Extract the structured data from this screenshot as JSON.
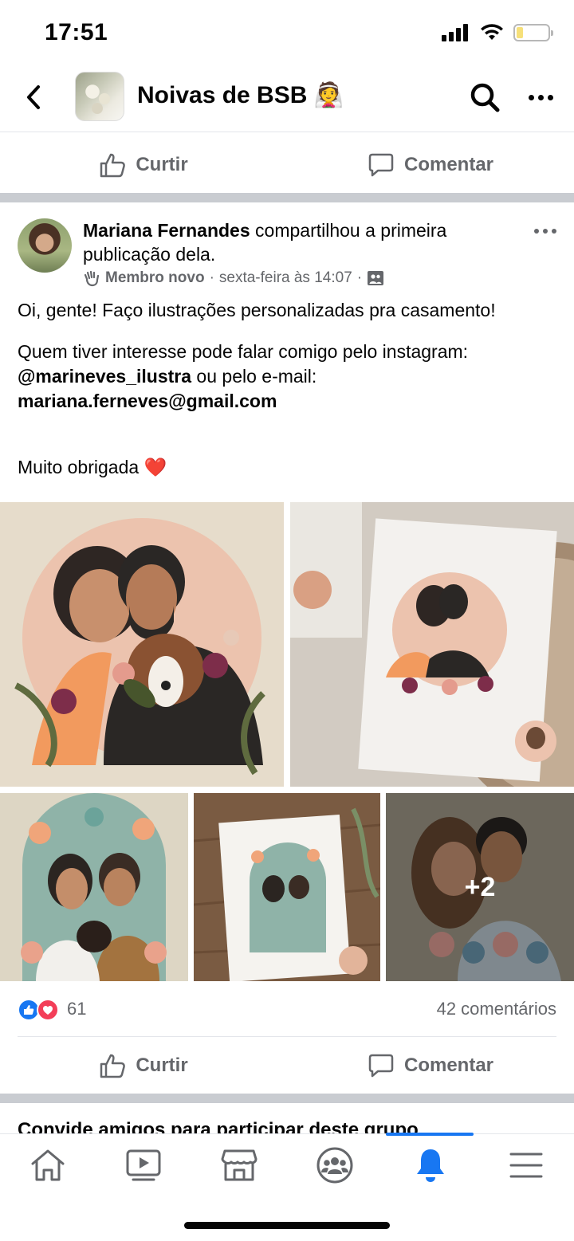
{
  "status_bar": {
    "time": "17:51"
  },
  "header": {
    "group_name": "Noivas de BSB 👰"
  },
  "actions_top": {
    "like": "Curtir",
    "comment": "Comentar"
  },
  "post": {
    "author": "Mariana Fernandes",
    "shared_text": " compartilhou a primeira publicação dela.",
    "badge": "Membro novo",
    "time": "sexta-feira às 14:07",
    "separator": "·",
    "body": {
      "line1": "Oi, gente! Faço ilustrações personalizadas pra casamento!",
      "line2_a": "Quem tiver interesse pode falar comigo pelo instagram:",
      "instagram": "@marineves_ilustra",
      "line2_b": " ou pelo e-mail:",
      "email": "mariana.ferneves@gmail.com",
      "thanks": "Muito obrigada ❤️"
    },
    "more_photos": "+2",
    "reaction_count": "61",
    "comments": "42 comentários"
  },
  "actions_bottom": {
    "like": "Curtir",
    "comment": "Comentar"
  },
  "next_card": {
    "title": "Convide amigos para participar deste grupo"
  },
  "colors": {
    "accent": "#1877f2",
    "love": "#f33e58",
    "secondary_text": "#65676b",
    "divider": "#c9ccd1"
  },
  "tabs": [
    "home-icon",
    "video-icon",
    "marketplace-icon",
    "groups-icon",
    "notifications-icon",
    "menu-icon"
  ]
}
